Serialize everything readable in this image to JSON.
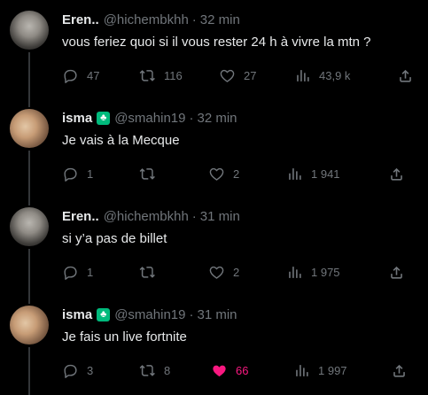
{
  "tweets": [
    {
      "name": "Eren..",
      "handle": "@hichembkhh",
      "time": "32 min",
      "text": "vous feriez quoi si il vous rester 24 h à vivre la mtn ?",
      "replies": "47",
      "retweets": "116",
      "likes": "27",
      "views": "43,9 k",
      "liked": false
    },
    {
      "name": "isma",
      "badge_icon": "club-badge-icon",
      "handle": "@smahin19",
      "time": "32 min",
      "text": "Je vais à la Mecque",
      "replies": "1",
      "retweets": "",
      "likes": "2",
      "views": "1 941",
      "liked": false
    },
    {
      "name": "Eren..",
      "handle": "@hichembkhh",
      "time": "31 min",
      "text": "si y’a pas de billet",
      "replies": "1",
      "retweets": "",
      "likes": "2",
      "views": "1 975",
      "liked": false
    },
    {
      "name": "isma",
      "badge_icon": "club-badge-icon",
      "handle": "@smahin19",
      "time": "31 min",
      "text": "Je fais un live fortnite",
      "replies": "3",
      "retweets": "8",
      "likes": "66",
      "views": "1 997",
      "liked": true
    }
  ],
  "colors": {
    "background": "#000000",
    "text": "#e7e9ea",
    "muted": "#71767b",
    "like_active": "#f91880",
    "badge": "#00ba7c"
  }
}
